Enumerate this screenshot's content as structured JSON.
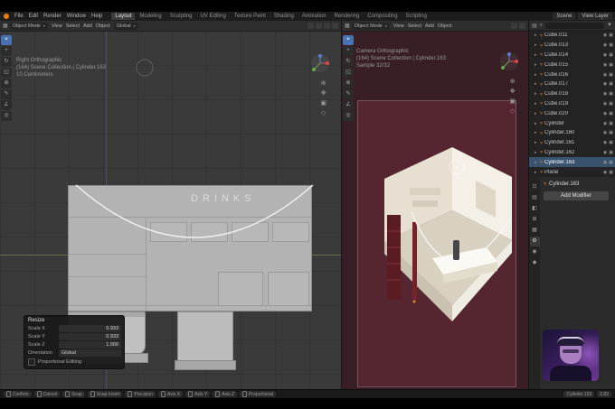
{
  "colors": {
    "accent_blue": "#4772b3",
    "mesh_orange": "#e8862d",
    "axis_x": "#d94b4b",
    "axis_y": "#6aa84f",
    "axis_z": "#5a7fd0",
    "selection_blue": "#39536f",
    "camera_view_maroon": "#552630"
  },
  "topbar": {
    "menus": [
      "File",
      "Edit",
      "Render",
      "Window",
      "Help"
    ],
    "tabs": [
      {
        "label": "Layout",
        "active": true
      },
      {
        "label": "Modeling"
      },
      {
        "label": "Sculpting"
      },
      {
        "label": "UV Editing"
      },
      {
        "label": "Texture Paint"
      },
      {
        "label": "Shading"
      },
      {
        "label": "Animation"
      },
      {
        "label": "Rendering"
      },
      {
        "label": "Compositing"
      },
      {
        "label": "Scripting"
      }
    ],
    "scene": "Scene",
    "view_layer": "View Layer"
  },
  "viewport_header": {
    "mode": "Object Mode",
    "menus": [
      "View",
      "Select",
      "Add",
      "Object"
    ],
    "orientation": "Global"
  },
  "tools": [
    {
      "glyph": "⌖",
      "active": true
    },
    {
      "glyph": "+"
    },
    {
      "glyph": "↻"
    },
    {
      "glyph": "◱"
    },
    {
      "glyph": "⊕"
    },
    {
      "glyph": "✎"
    },
    {
      "glyph": "∠"
    },
    {
      "glyph": "◎"
    }
  ],
  "nav_icons": [
    "⊕",
    "✥",
    "▣",
    "◇"
  ],
  "viewport_left": {
    "overlay": [
      "Right Orthographic",
      "(164) Scene Collection | Cylinder.163",
      "10 Centimeters"
    ]
  },
  "viewport_right": {
    "overlay": [
      "Camera Orthographic",
      "(164) Scene Collection | Cylinder.163",
      "Sample 32/32"
    ]
  },
  "model": {
    "sign": "DRINKS"
  },
  "operator_panel": {
    "title": "Resize",
    "rows": [
      {
        "label": "Scale X",
        "value": "0.933"
      },
      {
        "label": "Scale Y",
        "value": "0.933"
      },
      {
        "label": "Scale Z",
        "value": "1.000"
      }
    ],
    "orientation_label": "Orientation",
    "orientation_value": "Global",
    "checkbox_label": "Proportional Editing"
  },
  "outliner": {
    "icons": {
      "expand": "▸",
      "mesh": "▿",
      "visible": "◉",
      "render": "▣",
      "search": "⌕",
      "filter": "▼",
      "editor": "▤"
    },
    "items": [
      {
        "name": "Cube.011"
      },
      {
        "name": "Cube.013"
      },
      {
        "name": "Cube.014"
      },
      {
        "name": "Cube.015"
      },
      {
        "name": "Cube.016"
      },
      {
        "name": "Cube.017"
      },
      {
        "name": "Cube.018"
      },
      {
        "name": "Cube.019"
      },
      {
        "name": "Cube.020"
      },
      {
        "name": "Cylinder"
      },
      {
        "name": "Cylinder.160"
      },
      {
        "name": "Cylinder.161"
      },
      {
        "name": "Cylinder.162"
      },
      {
        "name": "Cylinder.163",
        "selected": true
      },
      {
        "name": "Plane"
      }
    ]
  },
  "properties": {
    "tabs": [
      {
        "glyph": "⊡"
      },
      {
        "glyph": "▤"
      },
      {
        "glyph": "◧"
      },
      {
        "glyph": "⊞"
      },
      {
        "glyph": "▦"
      },
      {
        "glyph": "⚙",
        "active": true
      },
      {
        "glyph": "◉"
      },
      {
        "glyph": "◆"
      }
    ],
    "object_name": "Cylinder.163",
    "add_modifier": "Add Modifier"
  },
  "statusbar": {
    "hints": [
      "Confirm",
      "Cancel",
      "Snap",
      "Snap Invert",
      "Precision",
      "Axis X",
      "Axis Y",
      "Axis Z",
      "Proportional"
    ],
    "right": [
      "Cylinder.163",
      "2.82"
    ]
  }
}
